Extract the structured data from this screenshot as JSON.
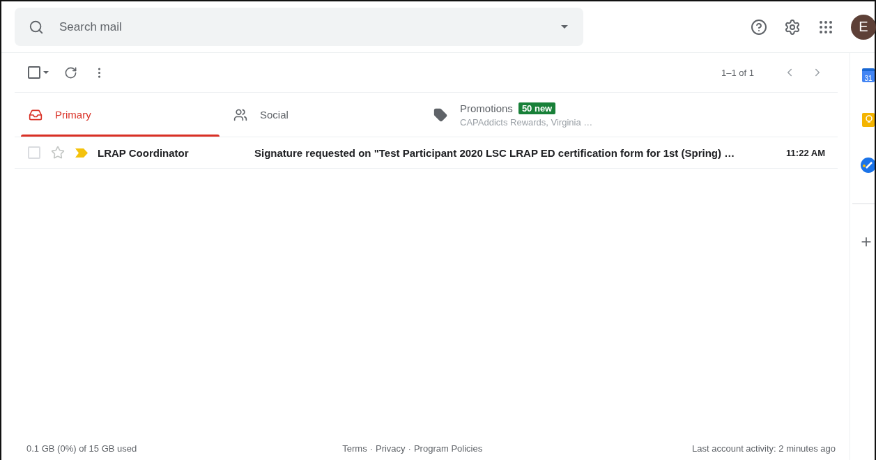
{
  "search": {
    "placeholder": "Search mail"
  },
  "account": {
    "initial": "E"
  },
  "toolbar": {
    "select_all_checked": false,
    "pagination": "1–1 of 1"
  },
  "tabs": [
    {
      "kind": "primary",
      "label": "Primary",
      "selected": true
    },
    {
      "kind": "social",
      "label": "Social",
      "selected": false
    },
    {
      "kind": "promotions",
      "label": "Promotions",
      "badge": "50 new",
      "snippet": "CAPAddicts Rewards, Virginia …",
      "selected": false
    }
  ],
  "emails": [
    {
      "sender": "LRAP Coordinator",
      "subject": "Signature requested on \"Test Participant 2020 LSC LRAP ED certification form for 1st (Spring) …",
      "time": "11:22 AM",
      "checked": false,
      "starred": false,
      "important": true,
      "unread": true
    }
  ],
  "side_panel": {
    "calendar_day": "31"
  },
  "footer": {
    "storage": "0.1 GB (0%) of 15 GB used",
    "separator": "·",
    "links": [
      "Terms",
      "Privacy",
      "Program Policies"
    ],
    "activity": "Last account activity: 2 minutes ago"
  }
}
